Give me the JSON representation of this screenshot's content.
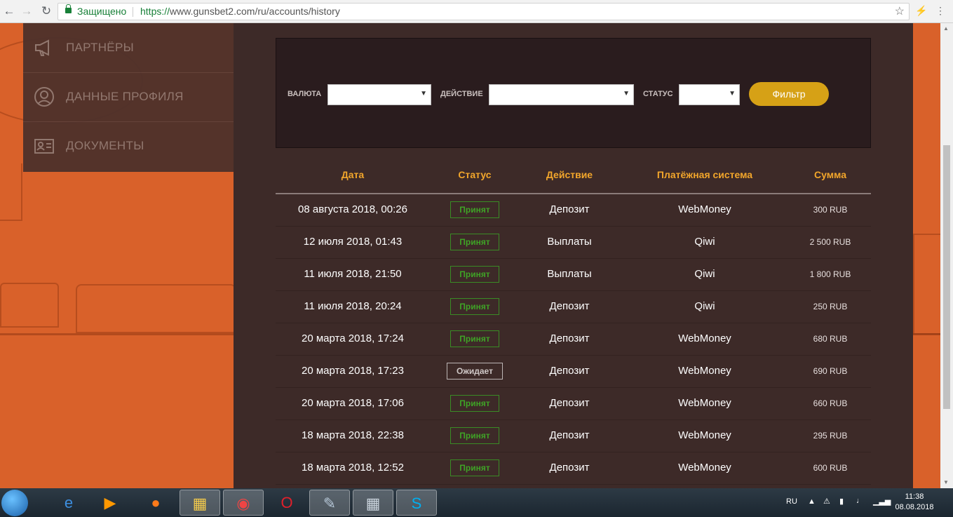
{
  "browser": {
    "secure_label": "Защищено",
    "url_scheme": "https://",
    "url_host": "www.gunsbet2.com",
    "url_path": "/ru/accounts/history",
    "back_icon": "back-arrow-icon",
    "forward_icon": "forward-arrow-icon",
    "reload_icon": "reload-icon"
  },
  "sidebar": {
    "items": [
      {
        "label": "ПАРТНЁРЫ",
        "icon": "megaphone-icon"
      },
      {
        "label": "ДАННЫЕ ПРОФИЛЯ",
        "icon": "user-icon"
      },
      {
        "label": "ДОКУМЕНТЫ",
        "icon": "id-card-icon"
      }
    ]
  },
  "filter": {
    "currency_label": "ВАЛЮТА",
    "currency_value": "",
    "action_label": "ДЕЙСТВИЕ",
    "action_value": "",
    "status_label": "СТАТУС",
    "status_value": "",
    "button_label": "Фильтр"
  },
  "table": {
    "headers": [
      "Дата",
      "Статус",
      "Действие",
      "Платёжная система",
      "Сумма"
    ],
    "rows": [
      {
        "date": "08 августа 2018, 00:26",
        "status": "Принят",
        "action": "Депозит",
        "system": "WebMoney",
        "sum": "300 RUB"
      },
      {
        "date": "12 июля 2018, 01:43",
        "status": "Принят",
        "action": "Выплаты",
        "system": "Qiwi",
        "sum": "2 500 RUB"
      },
      {
        "date": "11 июля 2018, 21:50",
        "status": "Принят",
        "action": "Выплаты",
        "system": "Qiwi",
        "sum": "1 800 RUB"
      },
      {
        "date": "11 июля 2018, 20:24",
        "status": "Принят",
        "action": "Депозит",
        "system": "Qiwi",
        "sum": "250 RUB"
      },
      {
        "date": "20 марта 2018, 17:24",
        "status": "Принят",
        "action": "Депозит",
        "system": "WebMoney",
        "sum": "680 RUB"
      },
      {
        "date": "20 марта 2018, 17:23",
        "status": "Ожидает",
        "action": "Депозит",
        "system": "WebMoney",
        "sum": "690 RUB"
      },
      {
        "date": "20 марта 2018, 17:06",
        "status": "Принят",
        "action": "Депозит",
        "system": "WebMoney",
        "sum": "660 RUB"
      },
      {
        "date": "18 марта 2018, 22:38",
        "status": "Принят",
        "action": "Депозит",
        "system": "WebMoney",
        "sum": "295 RUB"
      },
      {
        "date": "18 марта 2018, 12:52",
        "status": "Принят",
        "action": "Депозит",
        "system": "WebMoney",
        "sum": "600 RUB"
      }
    ]
  },
  "taskbar": {
    "language": "RU",
    "time": "11:38",
    "date": "08.08.2018"
  },
  "colors": {
    "accent": "#d6a116",
    "header_text": "#f2a62b",
    "accepted": "#3fa226",
    "page_bg": "#d9612a"
  }
}
